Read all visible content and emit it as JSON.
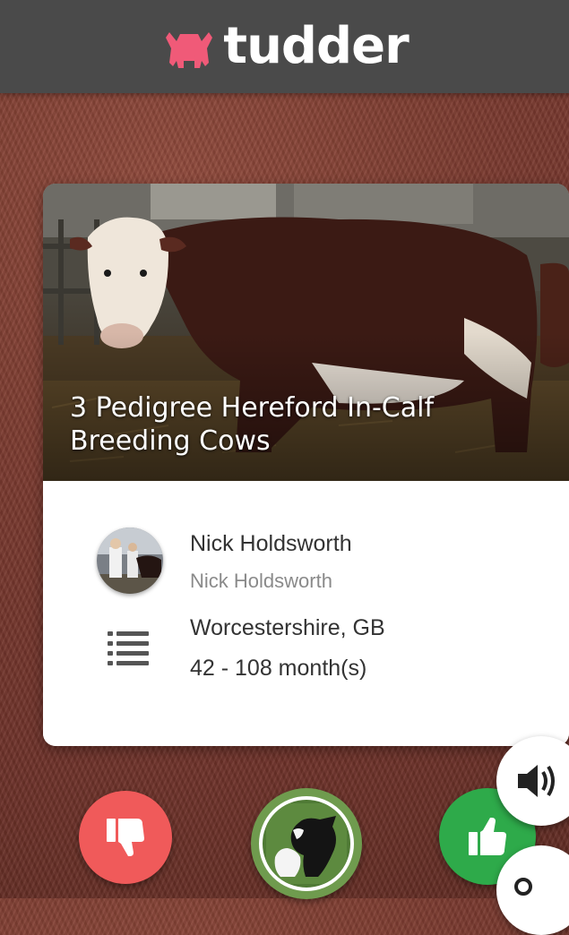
{
  "app": {
    "brand_name": "tudder",
    "brand_color": "#f05a78"
  },
  "listing": {
    "title": "3 Pedigree Hereford In-Calf Breeding Cows",
    "seller_name": "Nick Holdsworth",
    "seller_subtitle": "Nick Holdsworth",
    "location": "Worcestershire, GB",
    "age_range": "42 - 108 month(s)"
  },
  "actions": {
    "dislike": {
      "icon": "thumbs-down-icon",
      "color": "#f05a5a"
    },
    "profile": {
      "icon": "cow-profile-icon",
      "color": "#6f9b4e"
    },
    "like": {
      "icon": "thumbs-up-icon",
      "color": "#2eaa4a"
    },
    "sound": {
      "icon": "speaker-icon",
      "color": "#ffffff"
    },
    "extra": {
      "icon": "search-icon",
      "color": "#ffffff"
    }
  },
  "icons": {
    "details": "list-icon",
    "seller_avatar": "avatar"
  }
}
